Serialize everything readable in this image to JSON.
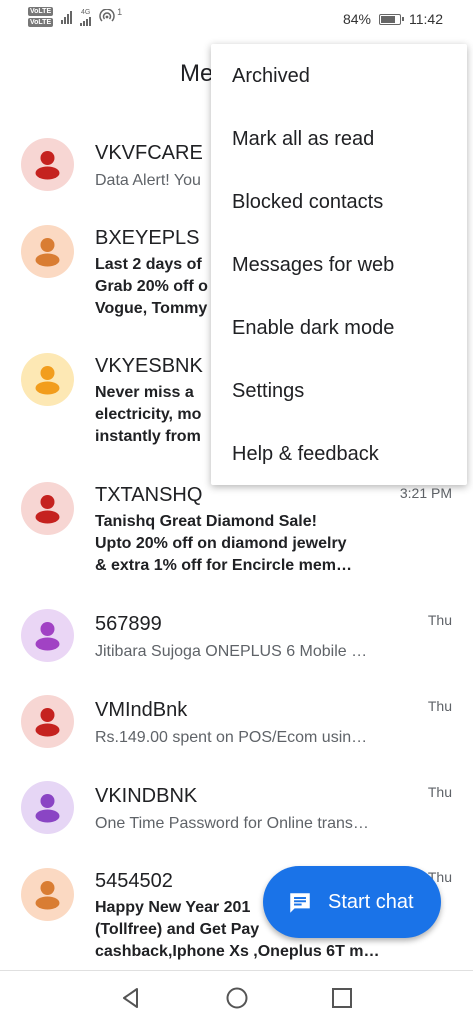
{
  "status_bar": {
    "sim1": "VoLTE",
    "sim2": "VoLTE",
    "network": "4G",
    "notif_count": "1",
    "battery": "84%",
    "battery_level": 0.84,
    "time": "11:42"
  },
  "app": {
    "title": "Me"
  },
  "menu": {
    "items": [
      "Archived",
      "Mark all as read",
      "Blocked contacts",
      "Messages for web",
      "Enable dark mode",
      "Settings",
      "Help & feedback"
    ]
  },
  "conversations": [
    {
      "sender": "VKVFCARE",
      "preview": "Data Alert! You",
      "time": "",
      "unread": false,
      "avatar_bg": "#f7d6d3",
      "avatar_fg": "#c5221f"
    },
    {
      "sender": "BXEYEPLS",
      "preview_lines": [
        "Last 2 days of",
        "Grab 20% off o",
        "Vogue, Tommy"
      ],
      "time": "",
      "unread": true,
      "avatar_bg": "#fbd9c2",
      "avatar_fg": "#d97d33"
    },
    {
      "sender": "VKYESBNK",
      "preview_lines": [
        "Never miss a",
        "electricity, mo",
        "instantly from"
      ],
      "time": "",
      "unread": true,
      "avatar_bg": "#fde8b4",
      "avatar_fg": "#f29d1d"
    },
    {
      "sender": "TXTANSHQ",
      "preview_lines": [
        "Tanishq Great Diamond Sale!",
        "Upto 20% off on diamond jewelry",
        "& extra 1% off for Encircle mem…"
      ],
      "time": "3:21 PM",
      "unread": true,
      "avatar_bg": "#f7d6d3",
      "avatar_fg": "#c5221f"
    },
    {
      "sender": "567899",
      "preview": "Jitibara Sujoga ONEPLUS 6 Mobile …",
      "time": "Thu",
      "unread": false,
      "avatar_bg": "#ead6f5",
      "avatar_fg": "#a142c4"
    },
    {
      "sender": "VMIndBnk",
      "preview": "Rs.149.00 spent on POS/Ecom usin…",
      "time": "Thu",
      "unread": false,
      "avatar_bg": "#f7d6d3",
      "avatar_fg": "#c5221f"
    },
    {
      "sender": "VKINDBNK",
      "preview": "One Time Password for Online trans…",
      "time": "Thu",
      "unread": false,
      "avatar_bg": "#e6d6f5",
      "avatar_fg": "#8a45c4"
    },
    {
      "sender": "5454502",
      "preview_lines": [
        "Happy New Year 201",
        "(Tollfree) and Get Pay",
        "cashback,Iphone Xs ,Oneplus 6T m…"
      ],
      "time": "Thu",
      "unread": true,
      "avatar_bg": "#fbd9c2",
      "avatar_fg": "#d97d33"
    }
  ],
  "fab": {
    "label": "Start chat"
  },
  "icons": {
    "avatar": "person-icon",
    "fab": "message-icon",
    "nav_back": "back-triangle-icon",
    "nav_home": "home-circle-icon",
    "nav_recents": "recents-square-icon"
  },
  "colors": {
    "accent": "#1a73e8"
  }
}
